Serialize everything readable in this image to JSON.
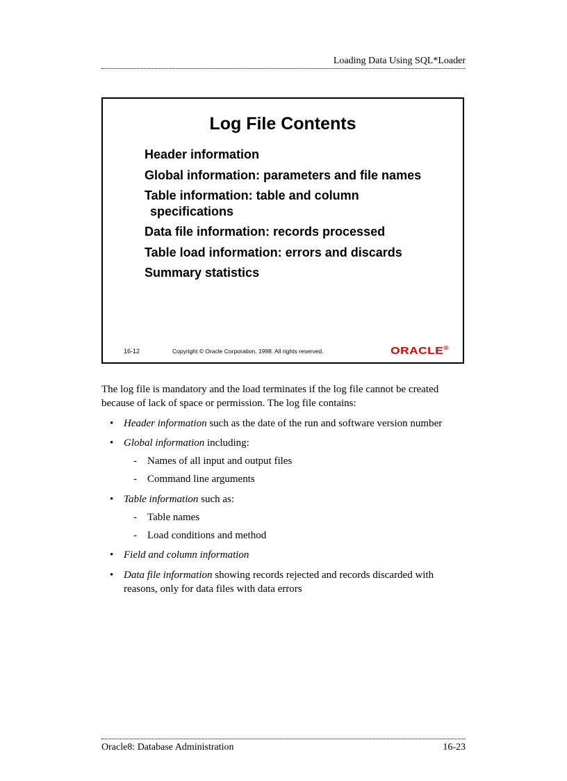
{
  "header": {
    "title": "Loading Data Using SQL*Loader"
  },
  "slide": {
    "title": "Log File Contents",
    "bullets": [
      "Header information",
      "Global information: parameters and file names",
      "Table information: table and column specifications",
      "Data file information: records processed",
      "Table load information: errors and discards",
      "Summary statistics"
    ],
    "page": "16-12",
    "copyright": "Copyright © Oracle Corporation, 1998. All rights reserved.",
    "logo": "ORACLE"
  },
  "body": {
    "intro": "The log file is mandatory and the load terminates if the log file cannot be created because of lack of space or permission. The log file contains:",
    "items": [
      {
        "italic": "Header information",
        "text": " such as the date of the run and software version number"
      },
      {
        "italic": "Global information",
        "text": " including:",
        "sub": [
          "Names of all input and output files",
          "Command line arguments"
        ]
      },
      {
        "italic": "Table information",
        "text": " such as:",
        "sub": [
          "Table names",
          "Load conditions and method"
        ]
      },
      {
        "italic": "Field and column information",
        "text": ""
      },
      {
        "italic": "Data file information",
        "text": " showing records rejected and records discarded with reasons, only for data files with data errors"
      }
    ]
  },
  "footer": {
    "left": "Oracle8: Database Administration",
    "right": "16-23"
  }
}
